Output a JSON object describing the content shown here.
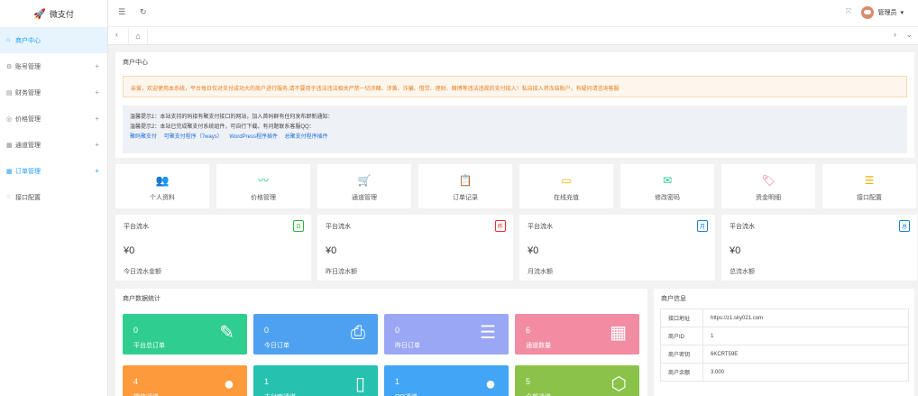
{
  "app": {
    "logo": "微支付"
  },
  "sidebar": {
    "items": [
      {
        "label": "商户中心",
        "icon": "home-icon",
        "glyph": "⌂",
        "expandable": false
      },
      {
        "label": "账号管理",
        "icon": "settings-icon",
        "glyph": "⚙",
        "expandable": true
      },
      {
        "label": "财务管理",
        "icon": "finance-icon",
        "glyph": "▤",
        "expandable": true
      },
      {
        "label": "价格管理",
        "icon": "price-icon",
        "glyph": "◎",
        "expandable": true
      },
      {
        "label": "通道管理",
        "icon": "channel-icon",
        "glyph": "▦",
        "expandable": true
      },
      {
        "label": "订单管理",
        "icon": "order-icon",
        "glyph": "▦",
        "expandable": true
      },
      {
        "label": "接口配置",
        "icon": "api-icon",
        "glyph": "◌",
        "expandable": false
      }
    ],
    "plus": "+"
  },
  "topbar": {
    "user": "管理员",
    "caret": "▾"
  },
  "page": {
    "title": "商户中心",
    "notice": "亲爱，欢迎使用本系统，平台每日仅对支付成功大的商户进行服务,请不要用于违法违法相关严禁一切涉赌、涉黄、诈骗、借贷、理财、赌博等违法违规的支付接入！私自接入将冻结账户，有疑问请咨询客服",
    "tips": [
      "温馨提示1：本站支持的码接有聚支付接口的网站，加入首码群有任何发布即新通知：",
      "温馨提示2：本站已完成聚支付系统组件，可自行下载。有问题联系客服QQ："
    ],
    "links": [
      "聚码聚支付",
      "可聚支付程序（7ways）",
      "WordPress程序插件",
      "总聚支付程序插件"
    ]
  },
  "quick": [
    {
      "label": "个人资料",
      "icon": "users-icon",
      "glyph": "👥",
      "color": "#1e9fff"
    },
    {
      "label": "价格管理",
      "icon": "pulse-icon",
      "glyph": "〰",
      "color": "#20c997"
    },
    {
      "label": "通道管理",
      "icon": "cart-icon",
      "glyph": "🛒",
      "color": "#ff7a45"
    },
    {
      "label": "订单记录",
      "icon": "clipboard-icon",
      "glyph": "📋",
      "color": "#8c6fe0"
    },
    {
      "label": "在线充值",
      "icon": "wallet-icon",
      "glyph": "▭",
      "color": "#fab005"
    },
    {
      "label": "修改密码",
      "icon": "mail-icon",
      "glyph": "✉",
      "color": "#20c997"
    },
    {
      "label": "资金明细",
      "icon": "tag-icon",
      "glyph": "🏷",
      "color": "#f06595"
    },
    {
      "label": "接口配置",
      "icon": "sliders-icon",
      "glyph": "☰",
      "color": "#fab005"
    }
  ],
  "stats": [
    {
      "title": "平台流水",
      "badge": "日",
      "badge_color": "#2fb344",
      "value": "¥0",
      "label": "今日流水金额"
    },
    {
      "title": "平台流水",
      "badge": "昨",
      "badge_color": "#e03131",
      "value": "¥0",
      "label": "昨日流水额"
    },
    {
      "title": "平台流水",
      "badge": "月",
      "badge_color": "#1c7ed6",
      "value": "¥0",
      "label": "月流水额"
    },
    {
      "title": "平台流水",
      "badge": "总",
      "badge_color": "#1c7ed6",
      "value": "¥0",
      "label": "总流水额"
    }
  ],
  "merchant_stats": {
    "title": "商户数据统计",
    "tiles": [
      {
        "value": "0",
        "label": "平台总订单",
        "color": "#2fce8f",
        "icon": "edit-icon",
        "glyph": "✎"
      },
      {
        "value": "0",
        "label": "今日订单",
        "color": "#4ea1f1",
        "icon": "printer-icon",
        "glyph": "⎙"
      },
      {
        "value": "0",
        "label": "昨日订单",
        "color": "#9aa7f5",
        "icon": "document-icon",
        "glyph": "☰"
      },
      {
        "value": "6",
        "label": "通道数量",
        "color": "#f18ca3",
        "icon": "calendar-icon",
        "glyph": "▦"
      },
      {
        "value": "4",
        "label": "微信通道",
        "color": "#fd9b3c",
        "icon": "wechat-icon",
        "glyph": "●"
      },
      {
        "value": "1",
        "label": "支付宝通道",
        "color": "#26c2b0",
        "icon": "phone-icon",
        "glyph": "▯"
      },
      {
        "value": "1",
        "label": "QQ通道",
        "color": "#42a5f5",
        "icon": "qq-icon",
        "glyph": "●"
      },
      {
        "value": "5",
        "label": "全部通道",
        "color": "#8bc34a",
        "icon": "cube-icon",
        "glyph": "⬡"
      }
    ]
  },
  "merchant_info": {
    "title": "商户信息",
    "rows": [
      {
        "key": "接口地址",
        "value": "https://z1.sky021.com"
      },
      {
        "key": "商户ID",
        "value": "1"
      },
      {
        "key": "商户密钥",
        "value": "6KCRT59E"
      },
      {
        "key": "商户余额",
        "value": "3.000"
      }
    ]
  }
}
